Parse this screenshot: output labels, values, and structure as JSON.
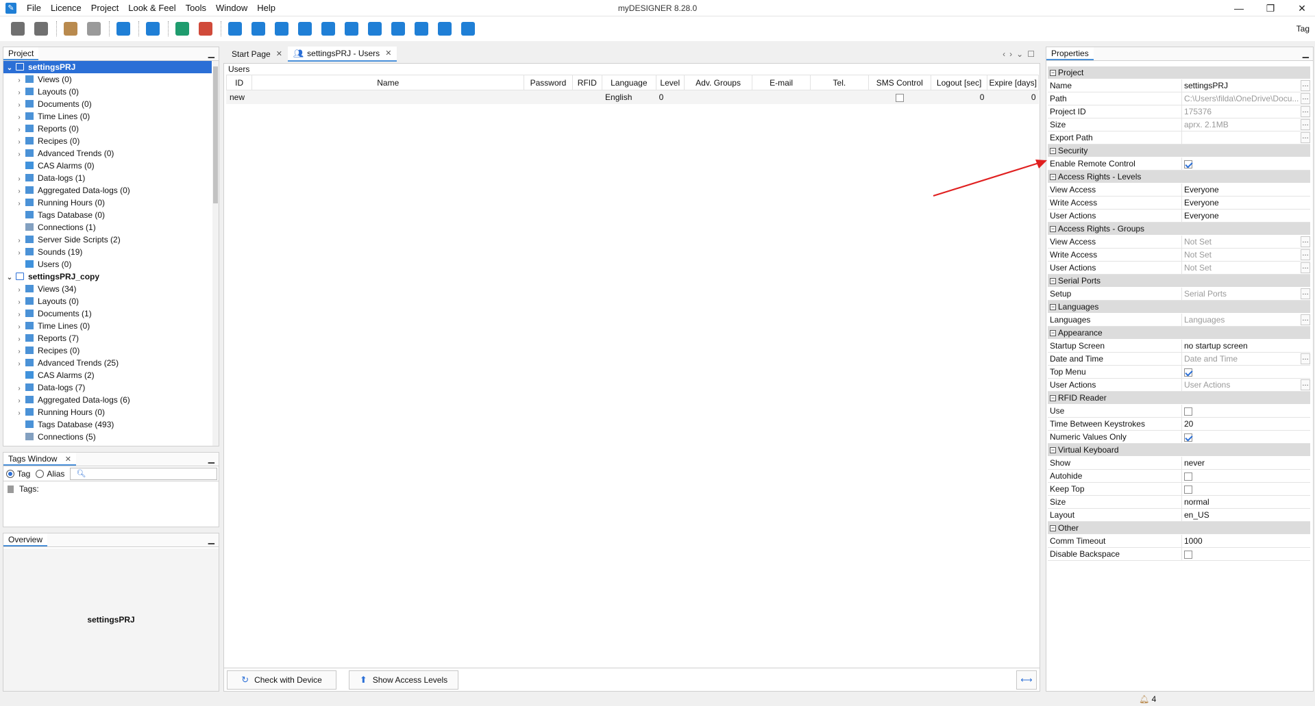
{
  "app": {
    "title": "myDESIGNER 8.28.0"
  },
  "menu": [
    "File",
    "Licence",
    "Project",
    "Look & Feel",
    "Tools",
    "Window",
    "Help"
  ],
  "toolbar": {
    "right_label": "Tag",
    "buttons": [
      {
        "icon": "save-icon",
        "color": "#707070"
      },
      {
        "icon": "save-all-icon",
        "color": "#707070"
      },
      {
        "sep": true
      },
      {
        "icon": "undo-icon",
        "color": "#b98a4e"
      },
      {
        "icon": "redo-icon",
        "color": "#9a9a9a"
      },
      {
        "sep": true
      },
      {
        "icon": "properties-icon",
        "color": "#1f7fd6"
      },
      {
        "sep": true
      },
      {
        "icon": "info-icon",
        "color": "#1f7fd6"
      },
      {
        "sep": true
      },
      {
        "icon": "import-icon",
        "color": "#1f9c6e"
      },
      {
        "icon": "export-icon",
        "color": "#d04a3a"
      },
      {
        "sep": true
      },
      {
        "icon": "add-view-icon",
        "color": "#1f7fd6"
      },
      {
        "icon": "remove-view-icon",
        "color": "#1f7fd6"
      },
      {
        "icon": "palette-icon",
        "color": "#1f7fd6"
      },
      {
        "icon": "checklist-icon",
        "color": "#1f7fd6"
      },
      {
        "icon": "login-icon",
        "color": "#1f7fd6"
      },
      {
        "icon": "translate-icon",
        "color": "#1f7fd6"
      },
      {
        "icon": "translate-alt-icon",
        "color": "#1f7fd6"
      },
      {
        "icon": "upload-icon",
        "color": "#1f7fd6"
      },
      {
        "icon": "download-icon",
        "color": "#1f7fd6"
      },
      {
        "icon": "open-external-icon",
        "color": "#1f7fd6"
      },
      {
        "icon": "collapse-icon",
        "color": "#1f7fd6"
      }
    ]
  },
  "project_panel": {
    "title": "Project",
    "tree": [
      {
        "label": "settingsPRJ",
        "level": 0,
        "expanded": true,
        "selected": true,
        "icon": "folder-icon"
      },
      {
        "label": "Views (0)",
        "level": 1,
        "icon": "view-icon"
      },
      {
        "label": "Layouts (0)",
        "level": 1,
        "icon": "layout-icon"
      },
      {
        "label": "Documents (0)",
        "level": 1,
        "icon": "document-icon"
      },
      {
        "label": "Time Lines (0)",
        "level": 1,
        "icon": "timeline-icon"
      },
      {
        "label": "Reports (0)",
        "level": 1,
        "icon": "report-icon"
      },
      {
        "label": "Recipes (0)",
        "level": 1,
        "icon": "recipe-icon"
      },
      {
        "label": "Advanced Trends (0)",
        "level": 1,
        "icon": "trend-icon"
      },
      {
        "label": "CAS Alarms (0)",
        "level": 1,
        "icon": "alarm-icon",
        "leaf": true
      },
      {
        "label": "Data-logs (1)",
        "level": 1,
        "icon": "datalog-icon"
      },
      {
        "label": "Aggregated Data-logs (0)",
        "level": 1,
        "icon": "aggregated-icon"
      },
      {
        "label": "Running Hours (0)",
        "level": 1,
        "icon": "clock-icon"
      },
      {
        "label": "Tags Database (0)",
        "level": 1,
        "icon": "database-icon",
        "leaf": true
      },
      {
        "label": "Connections (1)",
        "level": 1,
        "icon": "link-icon",
        "leaf": true
      },
      {
        "label": "Server Side Scripts (2)",
        "level": 1,
        "icon": "script-icon"
      },
      {
        "label": "Sounds (19)",
        "level": 1,
        "icon": "sound-icon"
      },
      {
        "label": "Users (0)",
        "level": 1,
        "icon": "users-icon",
        "leaf": true
      },
      {
        "label": "settingsPRJ_copy",
        "level": 0,
        "expanded": true,
        "icon": "folder-icon"
      },
      {
        "label": "Views (34)",
        "level": 1,
        "icon": "view-icon"
      },
      {
        "label": "Layouts (0)",
        "level": 1,
        "icon": "layout-icon"
      },
      {
        "label": "Documents (1)",
        "level": 1,
        "icon": "document-icon"
      },
      {
        "label": "Time Lines (0)",
        "level": 1,
        "icon": "timeline-icon"
      },
      {
        "label": "Reports (7)",
        "level": 1,
        "icon": "report-icon"
      },
      {
        "label": "Recipes (0)",
        "level": 1,
        "icon": "recipe-icon"
      },
      {
        "label": "Advanced Trends (25)",
        "level": 1,
        "icon": "trend-icon"
      },
      {
        "label": "CAS Alarms (2)",
        "level": 1,
        "icon": "alarm-icon",
        "leaf": true
      },
      {
        "label": "Data-logs (7)",
        "level": 1,
        "icon": "datalog-icon"
      },
      {
        "label": "Aggregated Data-logs (6)",
        "level": 1,
        "icon": "aggregated-icon"
      },
      {
        "label": "Running Hours (0)",
        "level": 1,
        "icon": "clock-icon"
      },
      {
        "label": "Tags Database (493)",
        "level": 1,
        "icon": "database-icon",
        "leaf": true
      },
      {
        "label": "Connections (5)",
        "level": 1,
        "icon": "link-icon",
        "leaf": true
      }
    ]
  },
  "tags_window": {
    "title": "Tags Window",
    "radio_tag": "Tag",
    "radio_alias": "Alias",
    "search_value": "",
    "tags_label": "Tags:"
  },
  "overview": {
    "title": "Overview",
    "project_name": "settingsPRJ"
  },
  "doc_tabs": [
    {
      "label": "Start Page",
      "active": false
    },
    {
      "label": "settingsPRJ - Users",
      "active": true
    }
  ],
  "users": {
    "title": "Users",
    "columns": [
      "ID",
      "Name",
      "Password",
      "RFID",
      "Language",
      "Level",
      "Adv. Groups",
      "E-mail",
      "Tel.",
      "SMS Control",
      "Logout [sec]",
      "Expire [days]"
    ],
    "rows": [
      {
        "id": "new",
        "name": "",
        "password": "",
        "rfid": "",
        "language": "English",
        "level": "0",
        "adv_groups": "",
        "email": "",
        "tel": "",
        "sms_control": false,
        "logout": "0",
        "expire": "0"
      }
    ],
    "buttons": {
      "check": "Check with Device",
      "access_levels": "Show Access Levels"
    }
  },
  "properties": {
    "title": "Properties",
    "sections": [
      {
        "title": "Project",
        "rows": [
          {
            "name": "Name",
            "value": "settingsPRJ",
            "dots": true
          },
          {
            "name": "Path",
            "value": "C:\\Users\\filda\\OneDrive\\Docu...",
            "muted": true,
            "dots": true
          },
          {
            "name": "Project ID",
            "value": "175376",
            "muted": true,
            "dots": true
          },
          {
            "name": "Size",
            "value": "aprx. 2.1MB",
            "muted": true,
            "dots": true
          },
          {
            "name": "Export Path",
            "value": "",
            "dots": true
          }
        ]
      },
      {
        "title": "Security",
        "rows": [
          {
            "name": "Enable Remote Control",
            "check": true
          }
        ]
      },
      {
        "title": "Access Rights - Levels",
        "rows": [
          {
            "name": "View Access",
            "value": "Everyone"
          },
          {
            "name": "Write Access",
            "value": "Everyone"
          },
          {
            "name": "User Actions",
            "value": "Everyone"
          }
        ]
      },
      {
        "title": "Access Rights - Groups",
        "rows": [
          {
            "name": "View Access",
            "value": "Not Set",
            "muted": true,
            "dots": true
          },
          {
            "name": "Write Access",
            "value": "Not Set",
            "muted": true,
            "dots": true
          },
          {
            "name": "User Actions",
            "value": "Not Set",
            "muted": true,
            "dots": true
          }
        ]
      },
      {
        "title": "Serial Ports",
        "rows": [
          {
            "name": "Setup",
            "value": "Serial Ports",
            "muted": true,
            "dots": true
          }
        ]
      },
      {
        "title": "Languages",
        "rows": [
          {
            "name": "Languages",
            "value": "Languages",
            "muted": true,
            "dots": true
          }
        ]
      },
      {
        "title": "Appearance",
        "rows": [
          {
            "name": "Startup Screen",
            "value": "no startup screen"
          },
          {
            "name": "Date and Time",
            "value": "Date and Time",
            "muted": true,
            "dots": true
          },
          {
            "name": "Top Menu",
            "check": true
          },
          {
            "name": "User Actions",
            "value": "User Actions",
            "muted": true,
            "dots": true
          }
        ]
      },
      {
        "title": "RFID Reader",
        "rows": [
          {
            "name": "Use",
            "check": false
          },
          {
            "name": "Time Between Keystrokes",
            "value": "20"
          },
          {
            "name": "Numeric Values Only",
            "check": true
          }
        ]
      },
      {
        "title": "Virtual Keyboard",
        "rows": [
          {
            "name": "Show",
            "value": "never"
          },
          {
            "name": "Autohide",
            "check": false
          },
          {
            "name": "Keep Top",
            "check": false
          },
          {
            "name": "Size",
            "value": "normal"
          },
          {
            "name": "Layout",
            "value": "en_US"
          }
        ]
      },
      {
        "title": "Other",
        "rows": [
          {
            "name": "Comm Timeout",
            "value": "1000"
          },
          {
            "name": "Disable Backspace",
            "check": false
          }
        ]
      }
    ]
  },
  "statusbar": {
    "count": "4"
  },
  "colors": {
    "accent": "#2b6fd6",
    "annotation_arrow": "#e02020"
  }
}
